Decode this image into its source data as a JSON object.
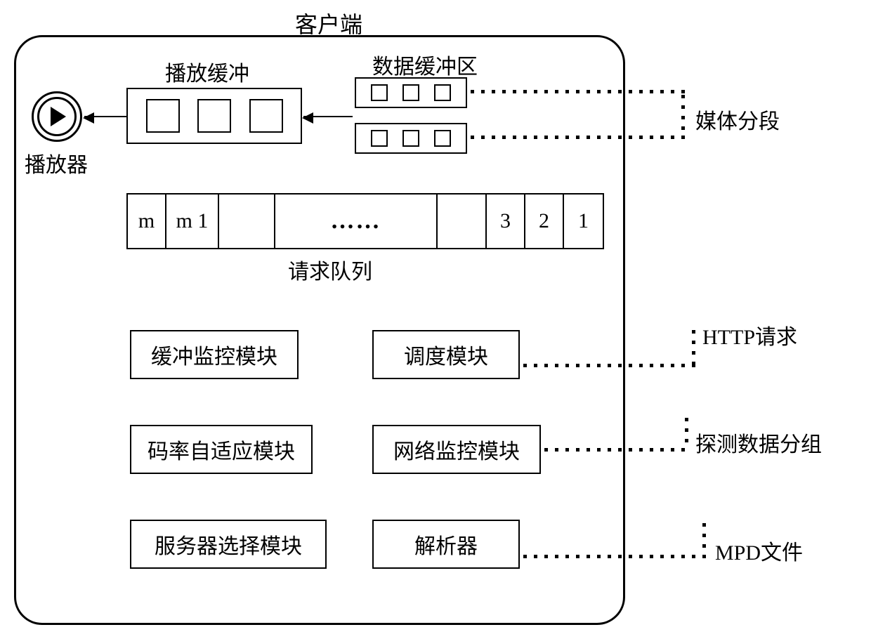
{
  "title": "客户端",
  "player_label": "播放器",
  "play_buffer_label": "播放缓冲",
  "data_buffer_label": "数据缓冲区",
  "media_segment_label": "媒体分段",
  "queue": {
    "label": "请求队列",
    "cells": [
      "m",
      "m 1",
      "",
      "……",
      "",
      "3",
      "2",
      "1"
    ]
  },
  "modules": {
    "buffer_monitor": "缓冲监控模块",
    "scheduler": "调度模块",
    "bitrate_adaptive": "码率自适应模块",
    "network_monitor": "网络监控模块",
    "server_select": "服务器选择模块",
    "parser": "解析器"
  },
  "annotations": {
    "http_request": "HTTP请求",
    "probe_packet": "探测数据分组",
    "mpd_file": "MPD文件"
  }
}
